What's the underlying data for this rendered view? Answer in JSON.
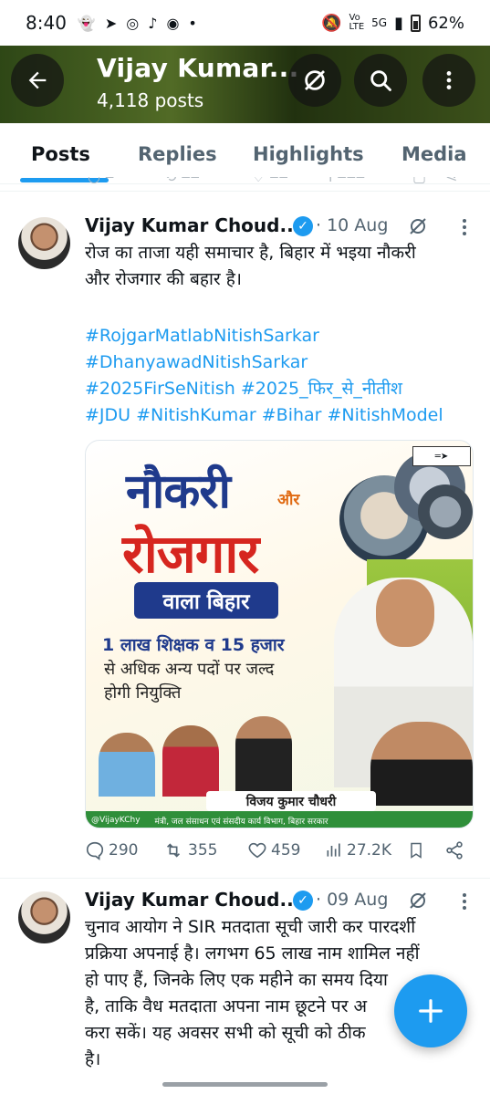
{
  "status_bar": {
    "time": "8:40",
    "network": "5G",
    "battery": "62%"
  },
  "header": {
    "title": "Vijay Kumar...",
    "post_count": "4,118 posts"
  },
  "tabs": [
    {
      "label": "Posts",
      "active": true
    },
    {
      "label": "Replies",
      "active": false
    },
    {
      "label": "Highlights",
      "active": false
    },
    {
      "label": "Media",
      "active": false
    }
  ],
  "posts": [
    {
      "author": "Vijay Kumar Choud...",
      "date": "· 10 Aug",
      "text_lines": [
        "रोज का ताजा यही समाचार है, बिहार में भइया नौकरी",
        "और रोजगार की बहार है।"
      ],
      "hashtag_lines": [
        "#RojgarMatlabNitishSarkar",
        "#DhanyawadNitishSarkar",
        "#2025FirSeNitish #2025_फिर_से_नीतीश",
        "#JDU #NitishKumar #Bihar #NitishModel"
      ],
      "media": {
        "headline_1": "नौकरी",
        "conjunction": "और",
        "headline_2": "रोजगार",
        "badge": "वाला बिहार",
        "line_1": "1 लाख शिक्षक व 15 हजार",
        "line_2": "से अधिक अन्य पदों पर जल्द",
        "line_3": "होगी नियुक्ति",
        "name_bar": "विजय कुमार चौधरी",
        "footer_handle": "@VijayKChy",
        "footer_title": "मंत्री, जल संसाधन एवं संसदीय कार्य विभाग, बिहार सरकार"
      },
      "stats": {
        "replies": "290",
        "reposts": "355",
        "likes": "459",
        "views": "27.2K"
      }
    },
    {
      "author": "Vijay Kumar Choud...",
      "date": "· 09 Aug",
      "text_lines": [
        "चुनाव आयोग ने SIR मतदाता सूची जारी कर पारदर्शी",
        "प्रक्रिया अपनाई है। लगभग 65 लाख नाम शामिल नहीं",
        "हो पाए हैं, जिनके लिए एक महीने का समय दिया",
        "है, ताकि वैध मतदाता अपना नाम छूटने पर अ",
        "करा सकें। यह अवसर सभी को सूची को ठीक",
        "है।"
      ]
    }
  ],
  "colors": {
    "accent": "#1d9bf0",
    "text_primary": "#0f1419",
    "text_secondary": "#536471"
  }
}
